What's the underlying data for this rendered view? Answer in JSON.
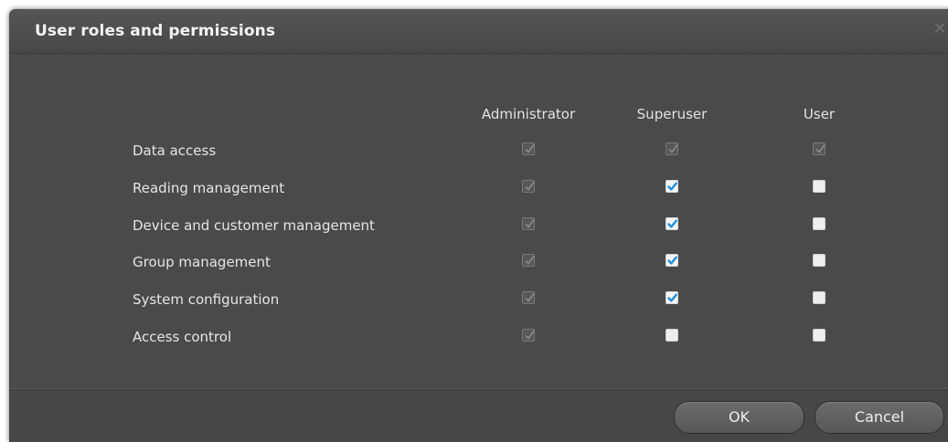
{
  "dialog": {
    "title": "User roles and permissions",
    "close_icon": "close-icon"
  },
  "columns": [
    "Administrator",
    "Superuser",
    "User"
  ],
  "rows": [
    {
      "label": "Data access",
      "administrator": "checked-disabled",
      "superuser": "checked-disabled",
      "user": "checked-disabled"
    },
    {
      "label": "Reading management",
      "administrator": "checked-disabled",
      "superuser": "checked",
      "user": "unchecked"
    },
    {
      "label": "Device and customer management",
      "administrator": "checked-disabled",
      "superuser": "checked",
      "user": "unchecked"
    },
    {
      "label": "Group management",
      "administrator": "checked-disabled",
      "superuser": "checked",
      "user": "unchecked"
    },
    {
      "label": "System configuration",
      "administrator": "checked-disabled",
      "superuser": "checked",
      "user": "unchecked"
    },
    {
      "label": "Access control",
      "administrator": "checked-disabled",
      "superuser": "unchecked",
      "user": "unchecked"
    }
  ],
  "buttons": {
    "ok_label": "OK",
    "cancel_label": "Cancel"
  },
  "colors": {
    "dialog_bg": "#4b4b4b",
    "check_accent": "#1e8fe0"
  }
}
